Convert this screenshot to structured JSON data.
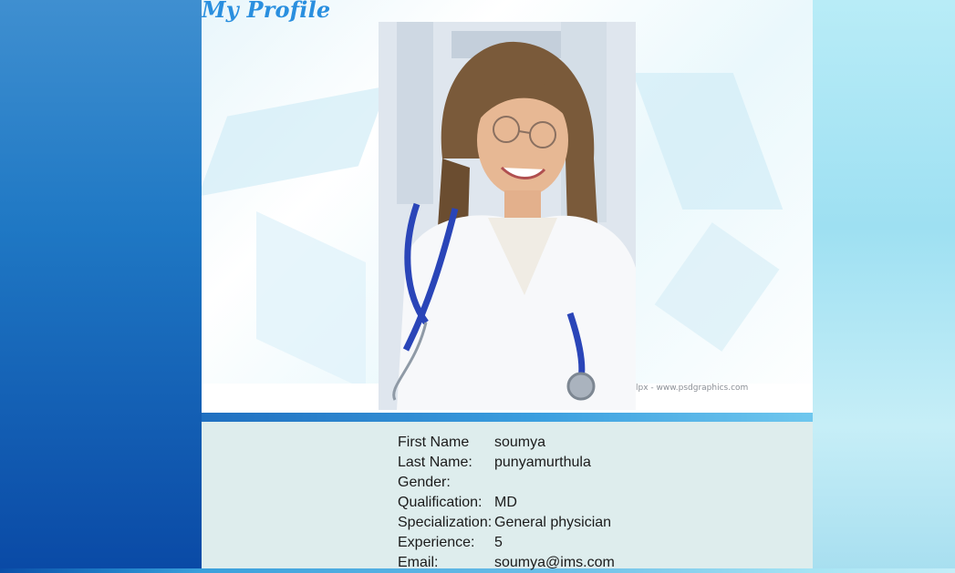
{
  "page": {
    "title": "My Profile"
  },
  "photo": {
    "watermark": "lpx  -  www.psdgraphics.com"
  },
  "profile": {
    "rows": [
      {
        "label": "First Name",
        "value": "soumya"
      },
      {
        "label": "Last Name:",
        "value": "punyamurthula"
      },
      {
        "label": "Gender:",
        "value": ""
      },
      {
        "label": "Qualification:",
        "value": "MD"
      },
      {
        "label": "Specialization:",
        "value": "General physician"
      },
      {
        "label": "Experience:",
        "value": "5"
      },
      {
        "label": "Email:",
        "value": "soumya@ims.com"
      }
    ]
  },
  "colors": {
    "title": "#2a8fdf",
    "panel": "#deeded",
    "divider": "#3b9fdf"
  }
}
